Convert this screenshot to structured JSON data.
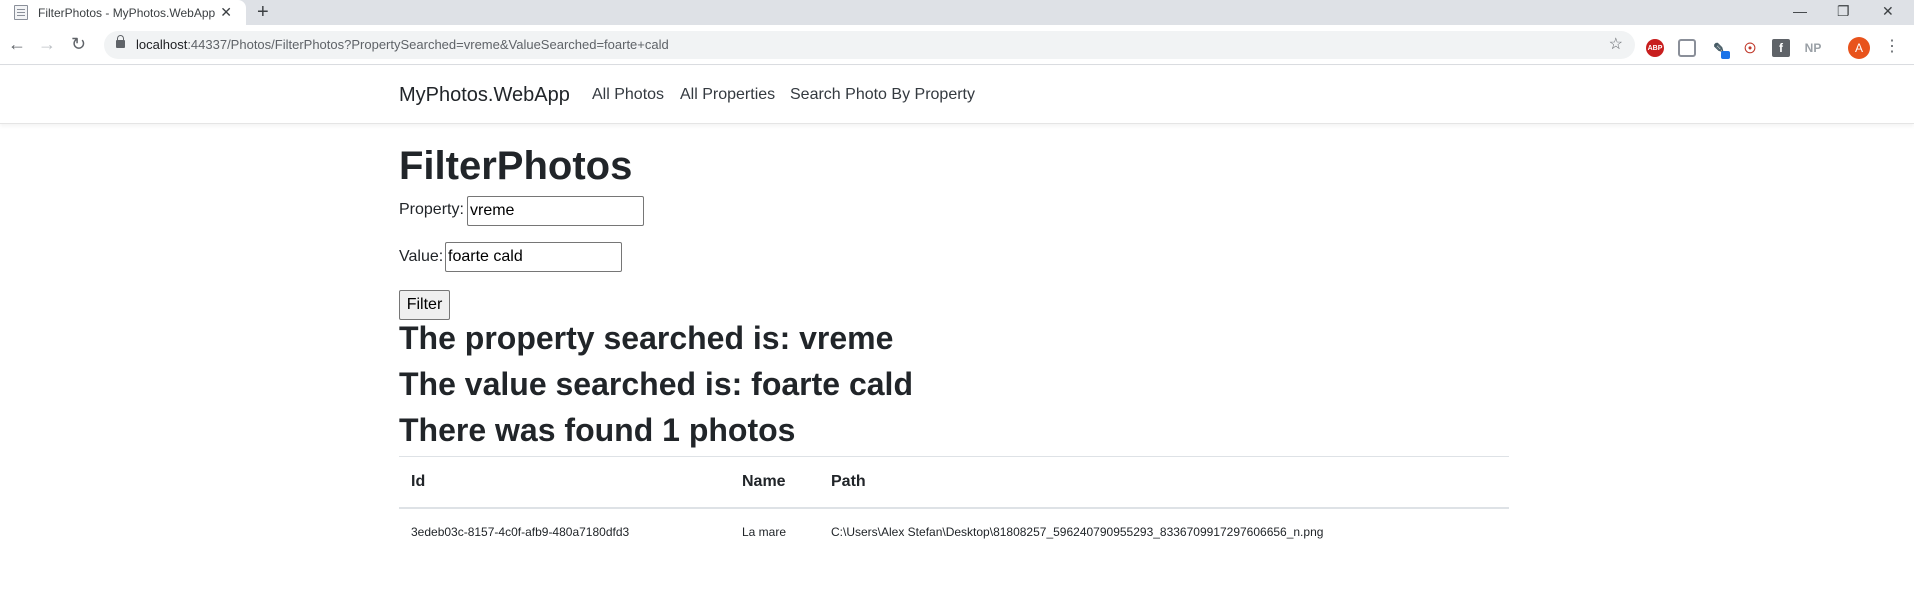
{
  "browser": {
    "tab_title": "FilterPhotos - MyPhotos.WebApp",
    "new_tab": "+",
    "close_tab": "✕",
    "url_host": "localhost",
    "url_rest": ":44337/Photos/FilterPhotos?PropertySearched=vreme&ValueSearched=foarte+cald",
    "extensions": {
      "abp": "ABP",
      "facebook": "f",
      "np": "NP",
      "avatar": "A"
    }
  },
  "navbar": {
    "brand": "MyPhotos.WebApp",
    "links": [
      "All Photos",
      "All Properties",
      "Search Photo By Property"
    ]
  },
  "page": {
    "title": "FilterPhotos",
    "property_label": "Property:",
    "property_value": "vreme",
    "value_label": "Value:",
    "value_value": "foarte cald",
    "filter_button": "Filter",
    "property_searched": "The property searched is: vreme",
    "value_searched": "The value searched is: foarte cald",
    "found_count": "There was found 1 photos"
  },
  "table": {
    "headers": [
      "Id",
      "Name",
      "Path"
    ],
    "rows": [
      [
        "3edeb03c-8157-4c0f-afb9-480a7180dfd3",
        "La mare",
        "C:\\Users\\Alex Stefan\\Desktop\\81808257_596240790955293_8336709917297606656_n.png"
      ]
    ]
  }
}
